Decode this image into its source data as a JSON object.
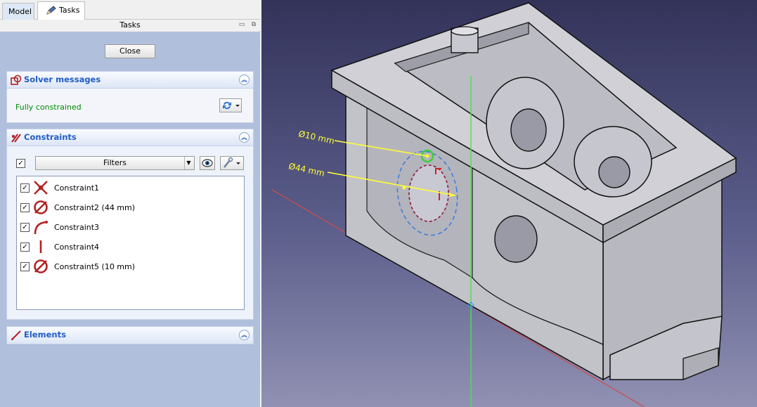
{
  "tabs": [
    {
      "label": "Model"
    },
    {
      "label": "Tasks"
    }
  ],
  "dock_title": "Tasks",
  "close_label": "Close",
  "solver": {
    "title": "Solver messages",
    "status": "Fully constrained"
  },
  "constraints": {
    "title": "Constraints",
    "filter_label": "Filters",
    "items": [
      {
        "label": "Constraint1",
        "icon": "coincident-icon"
      },
      {
        "label": "Constraint2 (44 mm)",
        "icon": "diameter-icon"
      },
      {
        "label": "Constraint3",
        "icon": "tangent-icon"
      },
      {
        "label": "Constraint4",
        "icon": "vertical-icon"
      },
      {
        "label": "Constraint5 (10 mm)",
        "icon": "diameter-icon"
      }
    ]
  },
  "elements": {
    "title": "Elements"
  },
  "viewport": {
    "dim1": "Ø10 mm",
    "dim2": "Ø44 mm"
  },
  "colors": {
    "accent": "#215dc6",
    "status_ok": "#008b00",
    "constraint_red": "#b22222",
    "viewport_top": "#33335a",
    "viewport_bottom": "#9191b3",
    "dim_yellow": "#ffff33"
  }
}
